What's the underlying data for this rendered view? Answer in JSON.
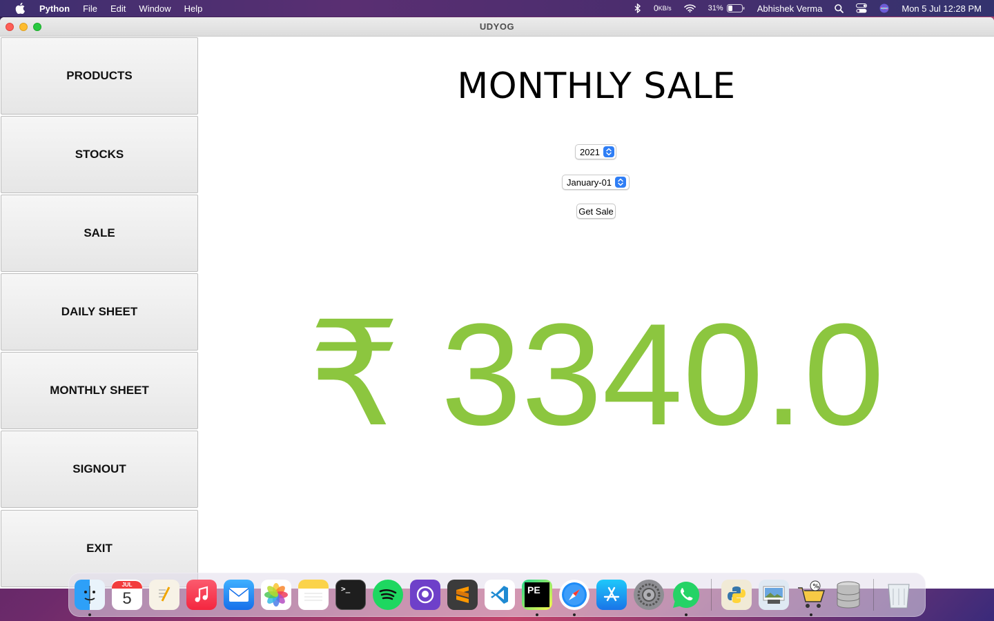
{
  "menubar": {
    "app_name": "Python",
    "menus": [
      "File",
      "Edit",
      "Window",
      "Help"
    ],
    "network_speed": "0",
    "network_unit": "KB/s",
    "battery_percent": "31%",
    "user_name": "Abhishek Verma",
    "datetime": "Mon 5 Jul  12:28 PM"
  },
  "window": {
    "title": "UDYOG"
  },
  "sidebar": {
    "items": [
      {
        "label": "PRODUCTS"
      },
      {
        "label": "STOCKS"
      },
      {
        "label": "SALE"
      },
      {
        "label": "DAILY SHEET"
      },
      {
        "label": "MONTHLY SHEET"
      },
      {
        "label": "SIGNOUT"
      },
      {
        "label": "EXIT"
      }
    ]
  },
  "main": {
    "title": "MONTHLY SALE",
    "year_select": {
      "value": "2021"
    },
    "month_select": {
      "value": "January-01"
    },
    "get_sale_label": "Get Sale",
    "sale_amount": "₹ 3340.0",
    "accent_color": "#8cc63f"
  },
  "dock": {
    "calendar_month": "JUL",
    "calendar_day": "5",
    "apps": [
      "finder",
      "calendar",
      "textedit",
      "music",
      "mail",
      "photos",
      "notes",
      "terminal",
      "spotify",
      "github-desktop",
      "sublime-text",
      "vscode",
      "pycharm",
      "safari",
      "app-store",
      "system-preferences",
      "whatsapp",
      "python-launcher",
      "preview",
      "shopping-cart",
      "database",
      "trash"
    ]
  }
}
